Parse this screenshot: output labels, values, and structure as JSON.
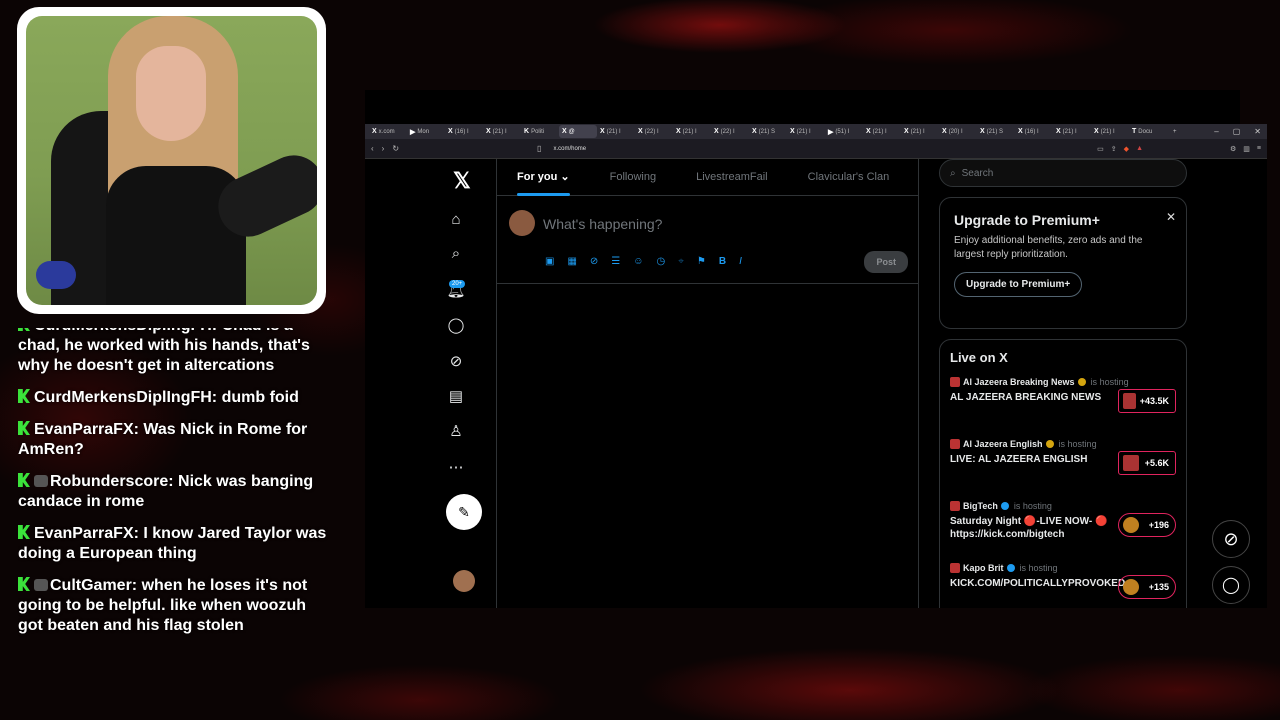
{
  "browser": {
    "tabs": [
      {
        "label": "x.com",
        "icon": "X"
      },
      {
        "label": "Mon",
        "icon": "▶"
      },
      {
        "label": "(16) I",
        "icon": "X"
      },
      {
        "label": "(21) I",
        "icon": "X"
      },
      {
        "label": "Politi",
        "icon": "K"
      },
      {
        "label": "@",
        "icon": "X",
        "active": true
      },
      {
        "label": "(21) I",
        "icon": "X"
      },
      {
        "label": "(22) I",
        "icon": "X"
      },
      {
        "label": "(21) I",
        "icon": "X"
      },
      {
        "label": "(22) I",
        "icon": "X"
      },
      {
        "label": "(21) S",
        "icon": "X"
      },
      {
        "label": "(21) I",
        "icon": "X"
      },
      {
        "label": "(51) I",
        "icon": "▶"
      },
      {
        "label": "(21) I",
        "icon": "X"
      },
      {
        "label": "(21) I",
        "icon": "X"
      },
      {
        "label": "(20) I",
        "icon": "X"
      },
      {
        "label": "(21) S",
        "icon": "X"
      },
      {
        "label": "(16) I",
        "icon": "X"
      },
      {
        "label": "(21) I",
        "icon": "X"
      },
      {
        "label": "(21) I",
        "icon": "X"
      },
      {
        "label": "Docu",
        "icon": "T"
      }
    ],
    "url": "x.com/home"
  },
  "feed": {
    "tabs": [
      "For you",
      "Following",
      "LivestreamFail",
      "Clavicular's Clan"
    ],
    "compose_placeholder": "What's happening?",
    "post_label": "Post"
  },
  "nav": {
    "notif_badge": "20+"
  },
  "search": {
    "placeholder": "Search"
  },
  "premium": {
    "title": "Upgrade to Premium+",
    "body": "Enjoy additional benefits, zero ads and the largest reply prioritization.",
    "button": "Upgrade to Premium+"
  },
  "live": {
    "title": "Live on X",
    "items": [
      {
        "host": "Al Jazeera Breaking News",
        "status": "is hosting",
        "title": "AL JAZEERA BREAKING NEWS",
        "count": "+43.5K"
      },
      {
        "host": "Al Jazeera English",
        "status": "is hosting",
        "title": "LIVE: AL JAZEERA ENGLISH",
        "count": "+5.6K"
      },
      {
        "host": "BigTech",
        "status": "is hosting",
        "title": "Saturday Night 🔴-LIVE NOW- 🔴 https://kick.com/bigtech",
        "count": "+196"
      },
      {
        "host": "Kapo Brit",
        "status": "is hosting",
        "title": "KICK.COM/POLITICALLYPROVOKED",
        "count": "+135"
      }
    ]
  },
  "chat": [
    {
      "user": "CurdMerkensDiplingFH",
      "text": "Chad is a chad, he worked with his hands, that's why he doesn't get in altercations",
      "partial": true
    },
    {
      "user": "CurdMerkensDiplIngFH",
      "text": "dumb foid"
    },
    {
      "user": "EvanParraFX",
      "text": "Was Nick in Rome for AmRen?"
    },
    {
      "user": "Robunderscore",
      "text": "Nick was banging candace in rome"
    },
    {
      "user": "EvanParraFX",
      "text": "I know Jared Taylor was doing a European thing"
    },
    {
      "user": "CultGamer",
      "text": "when he loses it's not going to be helpful. like when woozuh got beaten and his flag stolen"
    }
  ],
  "colors": {
    "accent": "#1d9bf0",
    "kick": "#3be33b",
    "live": "#e0245e"
  }
}
